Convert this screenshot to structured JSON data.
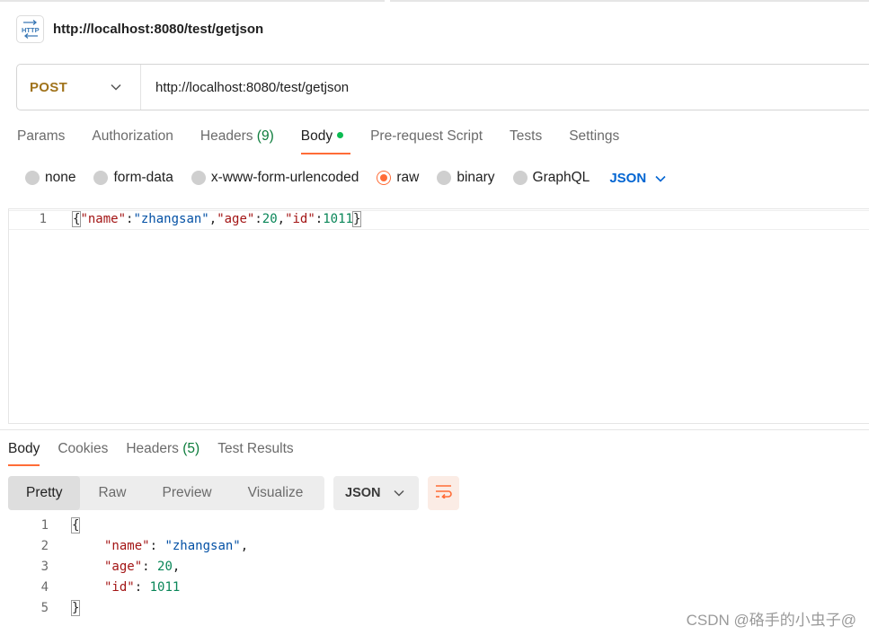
{
  "request": {
    "title": "http://localhost:8080/test/getjson",
    "method": "POST",
    "url": "http://localhost:8080/test/getjson"
  },
  "request_tabs": [
    {
      "label": "Params"
    },
    {
      "label": "Authorization"
    },
    {
      "label": "Headers",
      "count": "(9)"
    },
    {
      "label": "Body",
      "active": true
    },
    {
      "label": "Pre-request Script"
    },
    {
      "label": "Tests"
    },
    {
      "label": "Settings"
    }
  ],
  "body_types": [
    {
      "label": "none"
    },
    {
      "label": "form-data"
    },
    {
      "label": "x-www-form-urlencoded"
    },
    {
      "label": "raw",
      "selected": true
    },
    {
      "label": "binary"
    },
    {
      "label": "GraphQL"
    }
  ],
  "body_format": "JSON",
  "request_body": {
    "line_number": "1",
    "open": "{",
    "k1": "\"name\"",
    "colon1": ":",
    "v1": "\"zhangsan\"",
    "comma1": ",",
    "k2": "\"age\"",
    "colon2": ":",
    "v2": "20",
    "comma2": ",",
    "k3": "\"id\"",
    "colon3": ":",
    "v3": "1011",
    "close": "}"
  },
  "response_tabs": [
    {
      "label": "Body",
      "active": true
    },
    {
      "label": "Cookies"
    },
    {
      "label": "Headers",
      "count": "(5)"
    },
    {
      "label": "Test Results"
    }
  ],
  "response_views": [
    {
      "label": "Pretty",
      "active": true
    },
    {
      "label": "Raw"
    },
    {
      "label": "Preview"
    },
    {
      "label": "Visualize"
    }
  ],
  "response_format": "JSON",
  "response_body": {
    "line_numbers": [
      "1",
      "2",
      "3",
      "4",
      "5"
    ],
    "open": "{",
    "k1": "\"name\"",
    "v1": "\"zhangsan\"",
    "k2": "\"age\"",
    "v2": "20",
    "k3": "\"id\"",
    "v3": "1011",
    "colon": ":",
    "comma": ",",
    "close": "}"
  },
  "watermark": "CSDN @硌手的小虫子@",
  "colors": {
    "accent": "#ff6c37",
    "method": "#a0731b",
    "link_blue": "#0265d2",
    "count_green": "#0c7c3b",
    "json_key": "#a31515",
    "json_string": "#0451a5",
    "json_number": "#098658"
  }
}
